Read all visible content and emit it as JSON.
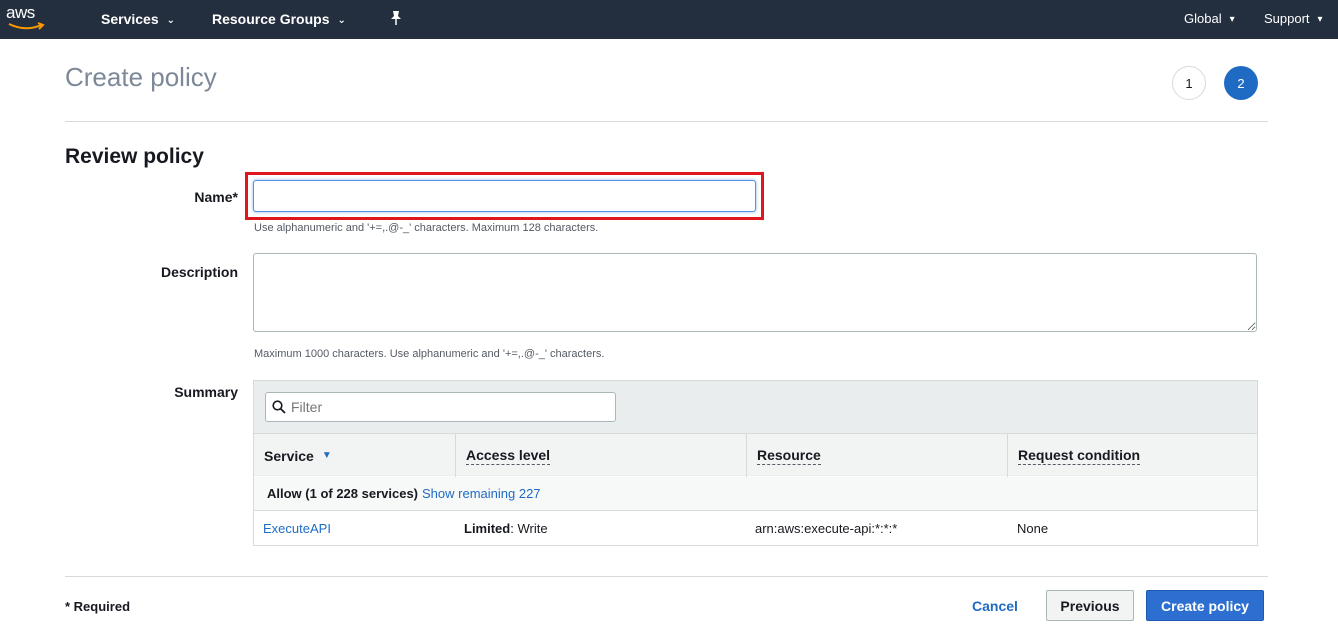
{
  "nav": {
    "logo": "aws",
    "services": "Services",
    "resource_groups": "Resource Groups",
    "region": "Global",
    "support": "Support"
  },
  "header": {
    "title": "Create policy",
    "steps": [
      "1",
      "2"
    ],
    "active_step": "2"
  },
  "form": {
    "section_title": "Review policy",
    "name_label": "Name*",
    "name_value": "",
    "name_hint": "Use alphanumeric and '+=,.@-_' characters. Maximum 128 characters.",
    "description_label": "Description",
    "description_value": "",
    "description_hint": "Maximum 1000 characters. Use alphanumeric and '+=,.@-_' characters.",
    "summary_label": "Summary"
  },
  "summary": {
    "filter_placeholder": "Filter",
    "columns": [
      "Service",
      "Access level",
      "Resource",
      "Request condition"
    ],
    "group": {
      "label": "Allow (1 of 228 services)",
      "link": "Show remaining 227"
    },
    "rows": [
      {
        "service": "ExecuteAPI",
        "access_bold": "Limited",
        "access_rest": ": Write",
        "resource": "arn:aws:execute-api:*:*:*",
        "condition": "None"
      }
    ]
  },
  "footer": {
    "required_note": "* Required",
    "cancel": "Cancel",
    "previous": "Previous",
    "create": "Create policy"
  },
  "colors": {
    "nav_bg": "#232f3e",
    "primary": "#2c6fd0",
    "link": "#1f6bc4",
    "highlight": "#e0161f"
  },
  "icons": [
    "aws-logo",
    "chevron-down-icon",
    "pin-icon",
    "search-icon",
    "sort-down-icon"
  ]
}
